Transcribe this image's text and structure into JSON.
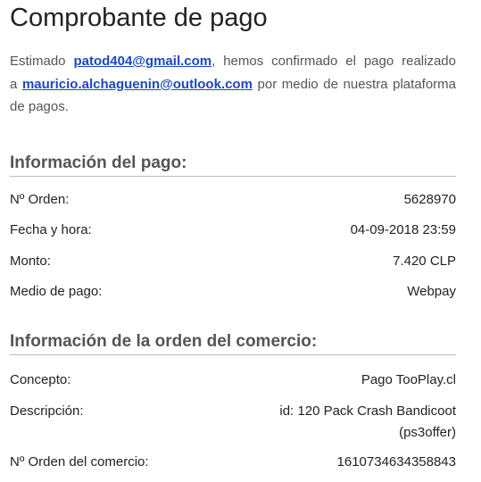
{
  "title": "Comprobante de pago",
  "intro": {
    "prefix": "Estimado",
    "sender_email": "patod404@gmail.com",
    "middle": ", hemos confirmado el pago realizado a",
    "recipient_email": "mauricio.alchaguenin@outlook.com",
    "suffix": "por medio de nuestra plataforma de pagos."
  },
  "payment_info": {
    "heading": "Información del pago:",
    "rows": [
      {
        "label": "Nº Orden:",
        "value": "5628970"
      },
      {
        "label": "Fecha y hora:",
        "value": "04-09-2018 23:59"
      },
      {
        "label": "Monto:",
        "value": "7.420 CLP"
      },
      {
        "label": "Medio de pago:",
        "value": "Webpay"
      }
    ]
  },
  "order_info": {
    "heading": "Información de la orden del comercio:",
    "rows": [
      {
        "label": "Concepto:",
        "value": "Pago TooPlay.cl"
      },
      {
        "label": "Descripción:",
        "value": "id: 120 Pack Crash Bandicoot (ps3offer)"
      },
      {
        "label": "Nº Orden del comercio:",
        "value": "1610734634358843"
      }
    ]
  }
}
